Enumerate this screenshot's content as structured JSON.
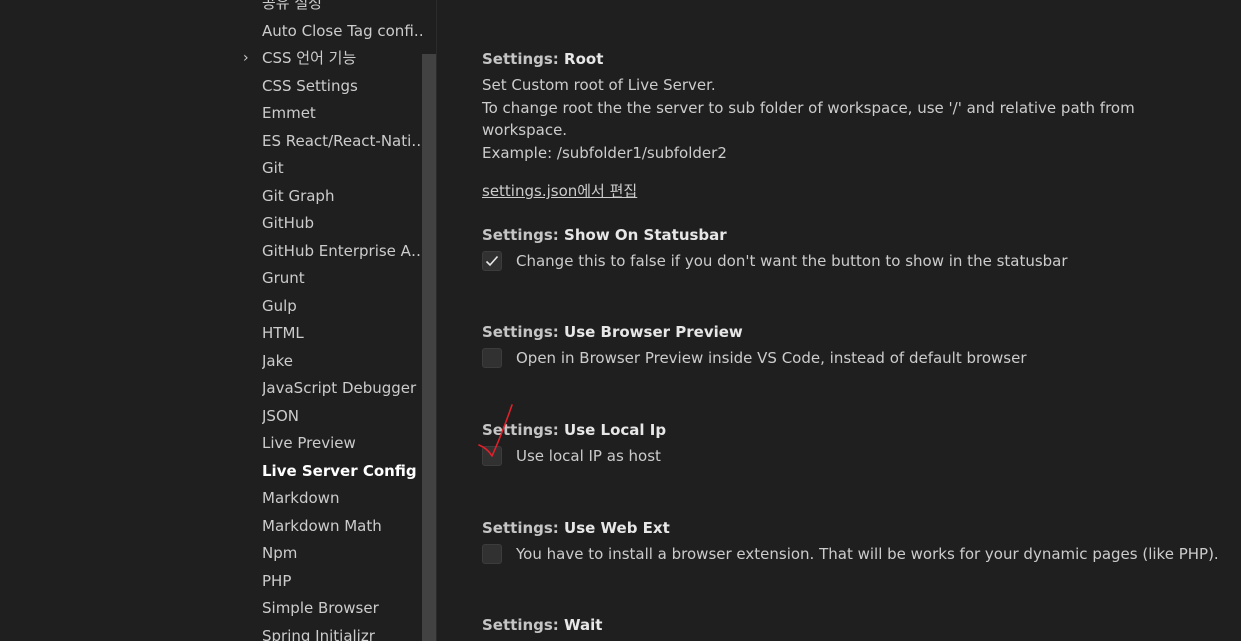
{
  "sidebar": {
    "items": [
      {
        "label": "공유 설정",
        "active": false,
        "chevron": false
      },
      {
        "label": "Auto Close Tag configuration",
        "active": false,
        "chevron": false
      },
      {
        "label": "CSS 언어 기능",
        "active": false,
        "chevron": true
      },
      {
        "label": "CSS Settings",
        "active": false,
        "chevron": false
      },
      {
        "label": "Emmet",
        "active": false,
        "chevron": false
      },
      {
        "label": "ES React/React-Native/Redux snippets",
        "active": false,
        "chevron": false
      },
      {
        "label": "Git",
        "active": false,
        "chevron": false
      },
      {
        "label": "Git Graph",
        "active": false,
        "chevron": false
      },
      {
        "label": "GitHub",
        "active": false,
        "chevron": false
      },
      {
        "label": "GitHub Enterprise Authentication",
        "active": false,
        "chevron": false
      },
      {
        "label": "Grunt",
        "active": false,
        "chevron": false
      },
      {
        "label": "Gulp",
        "active": false,
        "chevron": false
      },
      {
        "label": "HTML",
        "active": false,
        "chevron": false
      },
      {
        "label": "Jake",
        "active": false,
        "chevron": false
      },
      {
        "label": "JavaScript Debugger",
        "active": false,
        "chevron": false
      },
      {
        "label": "JSON",
        "active": false,
        "chevron": false
      },
      {
        "label": "Live Preview",
        "active": false,
        "chevron": false
      },
      {
        "label": "Live Server Config",
        "active": true,
        "chevron": false
      },
      {
        "label": "Markdown",
        "active": false,
        "chevron": false
      },
      {
        "label": "Markdown Math",
        "active": false,
        "chevron": false
      },
      {
        "label": "Npm",
        "active": false,
        "chevron": false
      },
      {
        "label": "PHP",
        "active": false,
        "chevron": false
      },
      {
        "label": "Simple Browser",
        "active": false,
        "chevron": false
      },
      {
        "label": "Spring Initializr",
        "active": false,
        "chevron": false
      }
    ],
    "chevron_icon": "chevron-right-icon"
  },
  "settings": {
    "root": {
      "category": "Settings: ",
      "key": "Root",
      "desc_lines": [
        "Set Custom root of Live Server.",
        "To change root the the server to sub folder of workspace, use '/' and relative path from workspace.",
        "Example: /subfolder1/subfolder2"
      ],
      "edit_link": "settings.json에서 편집"
    },
    "show_on_statusbar": {
      "category": "Settings: ",
      "key": "Show On Statusbar",
      "label": "Change this to false if you don't want the button to show in the statusbar",
      "checked": true
    },
    "use_browser_preview": {
      "category": "Settings: ",
      "key": "Use Browser Preview",
      "label": "Open in Browser Preview inside VS Code, instead of default browser",
      "checked": false
    },
    "use_local_ip": {
      "category": "Settings: ",
      "key": "Use Local Ip",
      "label": "Use local IP as host",
      "checked": false
    },
    "use_web_ext": {
      "category": "Settings: ",
      "key": "Use Web Ext",
      "label": "You have to install a browser extension. That will be works for your dynamic pages (like PHP).",
      "checked": false
    },
    "wait": {
      "category": "Settings: ",
      "key": "Wait"
    }
  },
  "colors": {
    "background": "#1f1f1f",
    "text": "#cccccc",
    "active_text": "#ffffff",
    "checkbox_bg": "#313131",
    "scrollbar_thumb": "#424242",
    "annotation": "#e0202a"
  }
}
